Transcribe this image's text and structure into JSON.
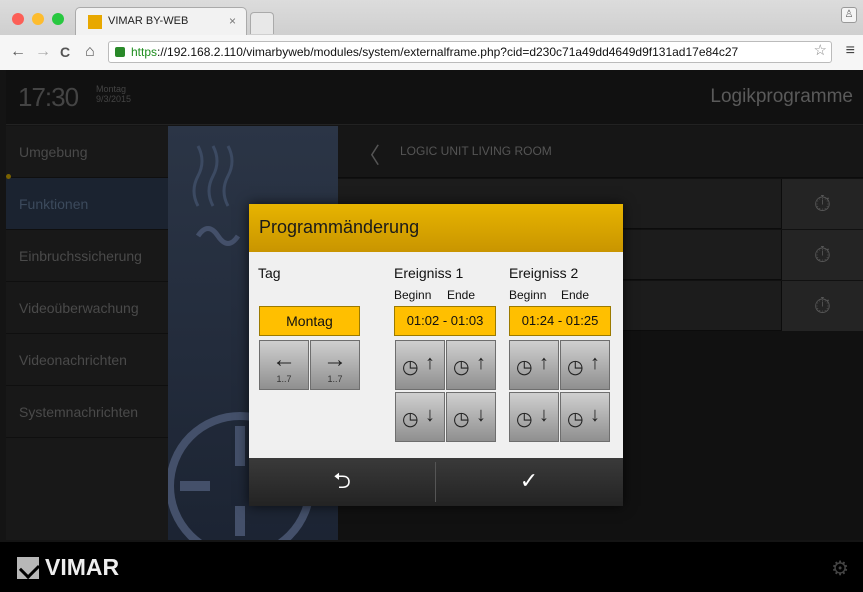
{
  "browser": {
    "tab_title": "VIMAR BY-WEB",
    "tab_close": "×",
    "url_scheme": "https",
    "url_rest": "://192.168.2.110/vimarbyweb/modules/system/externalframe.php?cid=d230c71a49dd4649d9f131ad17e84c27",
    "nav": {
      "back": "←",
      "forward": "→",
      "reload": "C",
      "home": "⌂"
    },
    "star": "☆",
    "menu": "≡",
    "profile": "♙",
    "traffic_colors": [
      "#fc5f57",
      "#fdbc2e",
      "#28c840"
    ]
  },
  "header": {
    "time": "17:30",
    "day": "Montag",
    "date": "9/3/2015",
    "section": "Logikprogramme"
  },
  "sidebar": {
    "items": [
      {
        "label": "Umgebung"
      },
      {
        "label": "Funktionen"
      },
      {
        "label": "Einbruchssicherung"
      },
      {
        "label": "Videoüberwachung"
      },
      {
        "label": "Videonachrichten"
      },
      {
        "label": "Systemnachrichten"
      }
    ]
  },
  "content": {
    "back": "〈",
    "title": "LOGIC UNIT LIVING ROOM",
    "row_button_icon": "⏱"
  },
  "dialog": {
    "title": "Programmänderung",
    "tag_label": "Tag",
    "day_value": "Montag",
    "prev_day": "←",
    "next_day": "→",
    "day_range": "1..7",
    "event1": {
      "label": "Ereigniss 1",
      "start_label": "Beginn",
      "end_label": "Ende",
      "value": "01:02 - 01:03"
    },
    "event2": {
      "label": "Ereigniss 2",
      "start_label": "Beginn",
      "end_label": "Ende",
      "value": "01:24 - 01:25"
    },
    "clock_icon": "◷",
    "up": "↑",
    "down": "↓",
    "cancel": "⮌",
    "confirm": "✓"
  },
  "footer": {
    "brand": "VIMAR",
    "settings_icon": "⚙"
  }
}
